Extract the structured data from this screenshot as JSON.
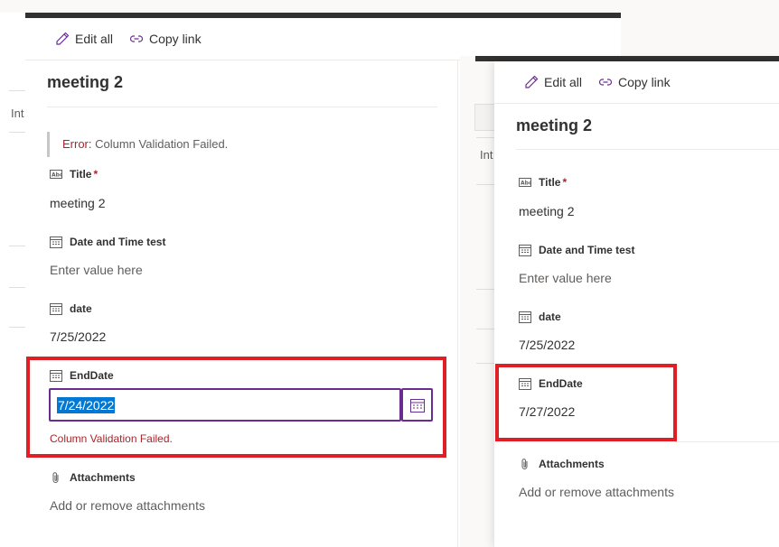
{
  "colors": {
    "accent": "#6b2c91",
    "error": "#a4262c",
    "highlight": "#e01e25",
    "selection": "#0078d4"
  },
  "background_list": {
    "col_header_partial": "Int"
  },
  "left_panel": {
    "toolbar": {
      "edit_all": "Edit all",
      "copy_link": "Copy link"
    },
    "title": "meeting 2",
    "error_banner": {
      "prefix": "Error:",
      "message": " Column Validation Failed."
    },
    "fields": {
      "title": {
        "label": "Title",
        "required": "*",
        "value": "meeting 2"
      },
      "date_time_test": {
        "label": "Date and Time test",
        "placeholder": "Enter value here"
      },
      "date": {
        "label": "date",
        "value": "7/25/2022"
      },
      "enddate": {
        "label": "EndDate",
        "value": "7/24/2022",
        "validation_error": "Column Validation Failed."
      },
      "attachments": {
        "label": "Attachments",
        "placeholder": "Add or remove attachments"
      }
    }
  },
  "right_panel": {
    "toolbar": {
      "edit_all": "Edit all",
      "copy_link": "Copy link"
    },
    "title": "meeting 2",
    "fields": {
      "title": {
        "label": "Title",
        "required": "*",
        "value": "meeting 2"
      },
      "date_time_test": {
        "label": "Date and Time test",
        "placeholder": "Enter value here"
      },
      "date": {
        "label": "date",
        "value": "7/25/2022"
      },
      "enddate": {
        "label": "EndDate",
        "value": "7/27/2022"
      },
      "attachments": {
        "label": "Attachments",
        "placeholder": "Add or remove attachments"
      }
    }
  }
}
